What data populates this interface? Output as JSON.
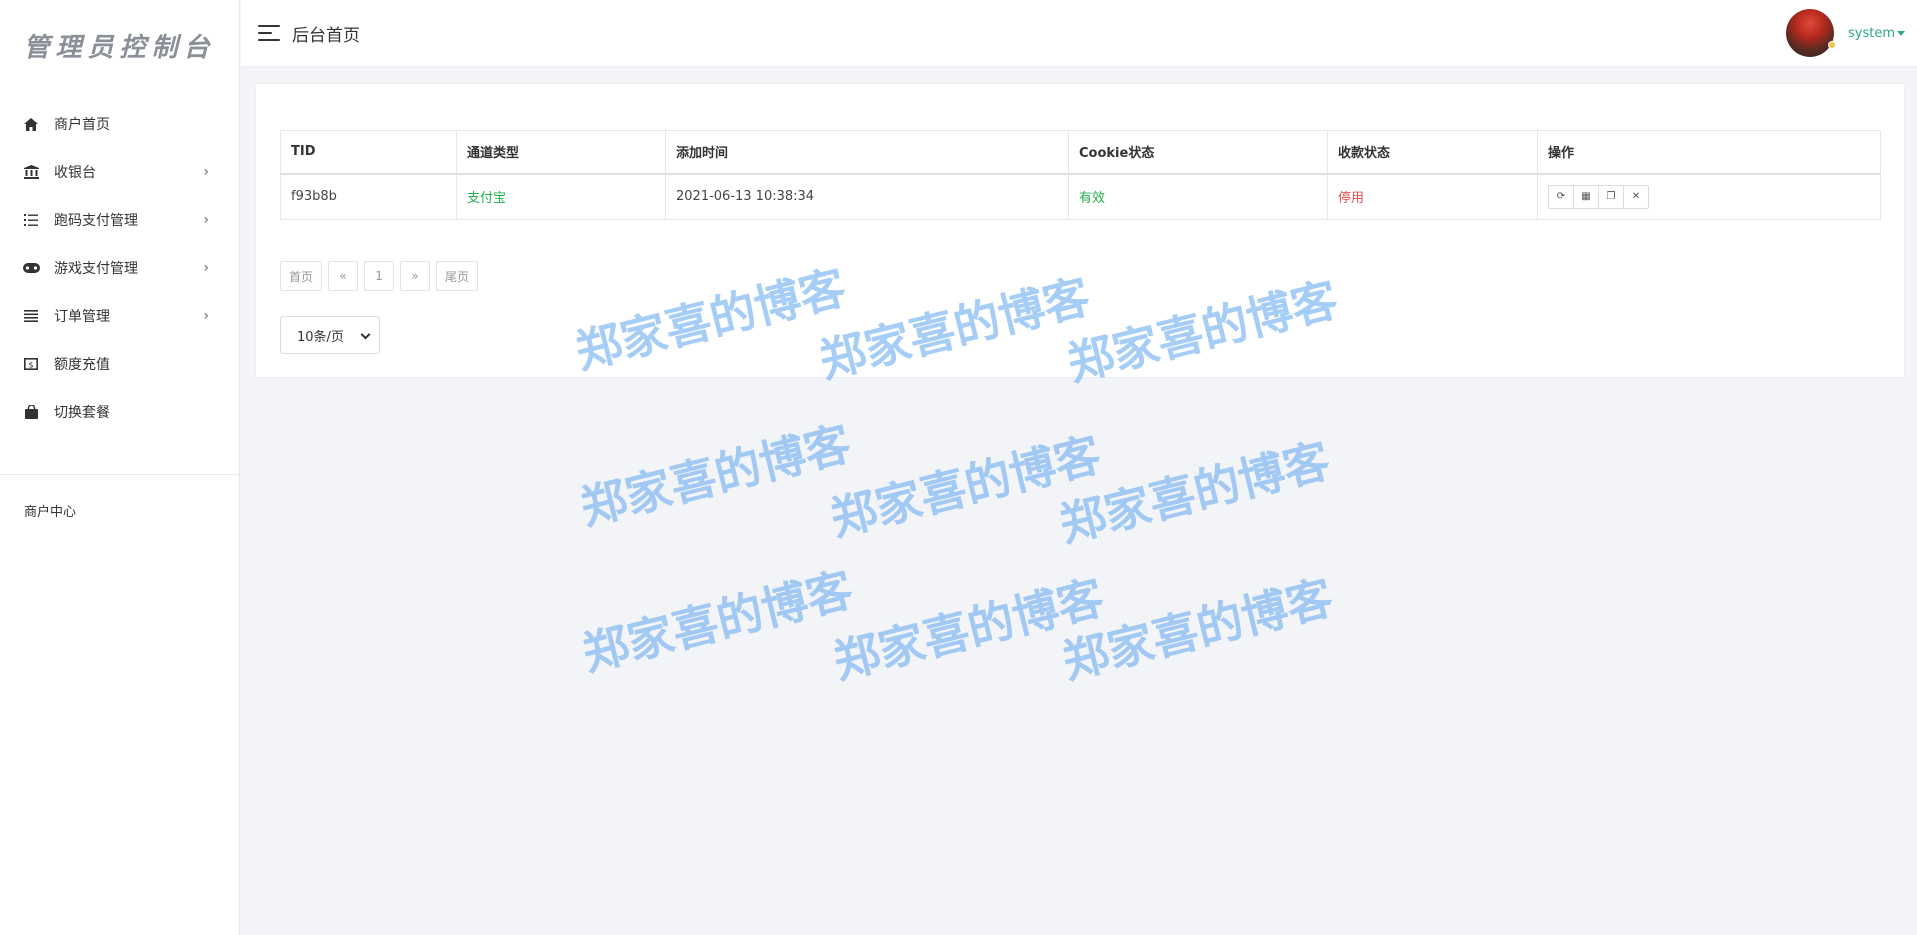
{
  "sidebar": {
    "logo": "管理员控制台",
    "menu": [
      {
        "label": "商户首页",
        "icon": "home-icon",
        "has_children": false
      },
      {
        "label": "收银台",
        "icon": "bank-icon",
        "has_children": true
      },
      {
        "label": "跑码支付管理",
        "icon": "list-icon",
        "has_children": true
      },
      {
        "label": "游戏支付管理",
        "icon": "gamepad-icon",
        "has_children": true
      },
      {
        "label": "订单管理",
        "icon": "bars-icon",
        "has_children": true
      },
      {
        "label": "额度充值",
        "icon": "money-icon",
        "has_children": false
      },
      {
        "label": "切换套餐",
        "icon": "bag-icon",
        "has_children": false
      }
    ],
    "section_title": "商户中心",
    "chevron": "›"
  },
  "header": {
    "title": "后台首页",
    "username": "system"
  },
  "table": {
    "columns": [
      "TID",
      "通道类型",
      "添加时间",
      "Cookie状态",
      "收款状态",
      "操作"
    ],
    "rows": [
      {
        "tid": "f93b8b",
        "channel": "支付宝",
        "added": "2021-06-13 10:38:34",
        "cookie_status": "有效",
        "pay_status": "停用"
      }
    ],
    "row_actions": [
      {
        "name": "refresh",
        "glyph": "⟳"
      },
      {
        "name": "qrcode",
        "glyph": "▦"
      },
      {
        "name": "copy",
        "glyph": "❐"
      },
      {
        "name": "delete",
        "glyph": "✕"
      }
    ]
  },
  "pagination": {
    "first": "首页",
    "prev": "«",
    "current": "1",
    "next": "»",
    "last": "尾页",
    "page_size": "10条/页"
  },
  "watermark": "郑家喜的博客",
  "colors": {
    "accent_green": "#2ca889",
    "status_green": "#22b04a",
    "status_red": "#e5504d",
    "watermark": "#6eaff0"
  }
}
